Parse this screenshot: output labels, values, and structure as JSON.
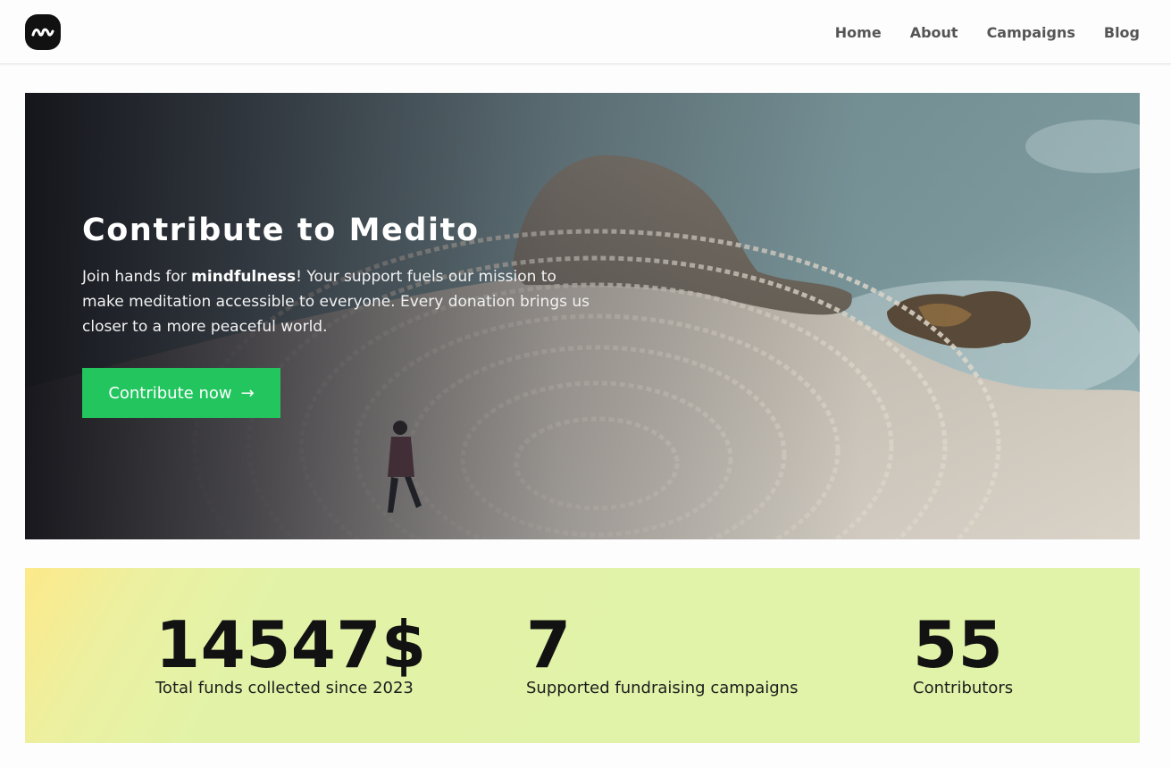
{
  "header": {
    "logo_icon": "medito-wave-logo-icon",
    "nav": [
      "Home",
      "About",
      "Campaigns",
      "Blog"
    ]
  },
  "hero": {
    "title": "Contribute to Medito",
    "text_before": "Join hands for ",
    "text_bold": "mindfulness",
    "text_after": "! Your support fuels our mission to make meditation accessible to everyone. Every donation brings us closer to a more peaceful world.",
    "cta_label": "Contribute now",
    "cta_icon": "arrow-right-icon",
    "cta_color": "#22c55e",
    "image_description_icon": "stone-labyrinth-coast-photo"
  },
  "stats": [
    {
      "value": "14547$",
      "label": "Total funds collected since 2023"
    },
    {
      "value": "7",
      "label": "Supported fundraising campaigns"
    },
    {
      "value": "55",
      "label": "Contributors"
    }
  ]
}
